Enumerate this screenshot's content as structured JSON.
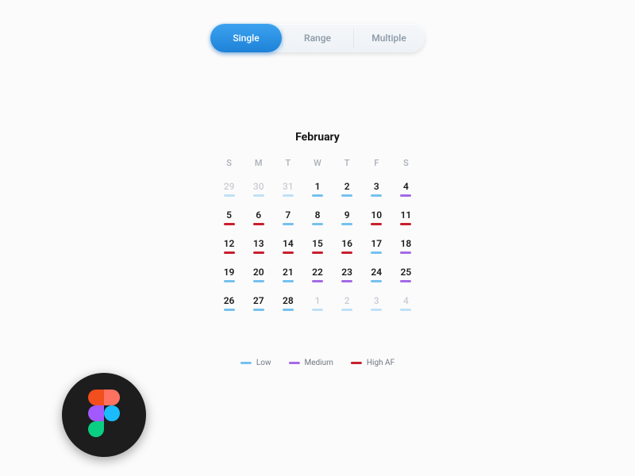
{
  "tabs": {
    "items": [
      {
        "label": "Single",
        "active": true
      },
      {
        "label": "Range",
        "active": false
      },
      {
        "label": "Multiple",
        "active": false
      }
    ]
  },
  "calendar": {
    "month_label": "February",
    "dow": [
      "S",
      "M",
      "T",
      "W",
      "T",
      "F",
      "S"
    ],
    "days": [
      {
        "n": "29",
        "out": true,
        "level": "low"
      },
      {
        "n": "30",
        "out": true,
        "level": "low"
      },
      {
        "n": "31",
        "out": true,
        "level": "low"
      },
      {
        "n": "1",
        "out": false,
        "level": "low"
      },
      {
        "n": "2",
        "out": false,
        "level": "low"
      },
      {
        "n": "3",
        "out": false,
        "level": "low"
      },
      {
        "n": "4",
        "out": false,
        "level": "medium"
      },
      {
        "n": "5",
        "out": false,
        "level": "high"
      },
      {
        "n": "6",
        "out": false,
        "level": "high"
      },
      {
        "n": "7",
        "out": false,
        "level": "low"
      },
      {
        "n": "8",
        "out": false,
        "level": "low"
      },
      {
        "n": "9",
        "out": false,
        "level": "low"
      },
      {
        "n": "10",
        "out": false,
        "level": "high"
      },
      {
        "n": "11",
        "out": false,
        "level": "high"
      },
      {
        "n": "12",
        "out": false,
        "level": "high"
      },
      {
        "n": "13",
        "out": false,
        "level": "high"
      },
      {
        "n": "14",
        "out": false,
        "level": "high"
      },
      {
        "n": "15",
        "out": false,
        "level": "high"
      },
      {
        "n": "16",
        "out": false,
        "level": "high"
      },
      {
        "n": "17",
        "out": false,
        "level": "low"
      },
      {
        "n": "18",
        "out": false,
        "level": "medium"
      },
      {
        "n": "19",
        "out": false,
        "level": "low"
      },
      {
        "n": "20",
        "out": false,
        "level": "low"
      },
      {
        "n": "21",
        "out": false,
        "level": "low"
      },
      {
        "n": "22",
        "out": false,
        "level": "medium"
      },
      {
        "n": "23",
        "out": false,
        "level": "medium"
      },
      {
        "n": "24",
        "out": false,
        "level": "low"
      },
      {
        "n": "25",
        "out": false,
        "level": "medium"
      },
      {
        "n": "26",
        "out": false,
        "level": "low"
      },
      {
        "n": "27",
        "out": false,
        "level": "low"
      },
      {
        "n": "28",
        "out": false,
        "level": "low"
      },
      {
        "n": "1",
        "out": true,
        "level": "low"
      },
      {
        "n": "2",
        "out": true,
        "level": "low"
      },
      {
        "n": "3",
        "out": true,
        "level": "low"
      },
      {
        "n": "4",
        "out": true,
        "level": "low"
      }
    ]
  },
  "legend": {
    "items": [
      {
        "label": "Low",
        "level": "low"
      },
      {
        "label": "Medium",
        "level": "medium"
      },
      {
        "label": "High AF",
        "level": "high"
      }
    ]
  },
  "colors": {
    "accent": "#1e82d8",
    "low": "#75c1ef",
    "medium": "#a46ae6",
    "high": "#c81f2d"
  }
}
